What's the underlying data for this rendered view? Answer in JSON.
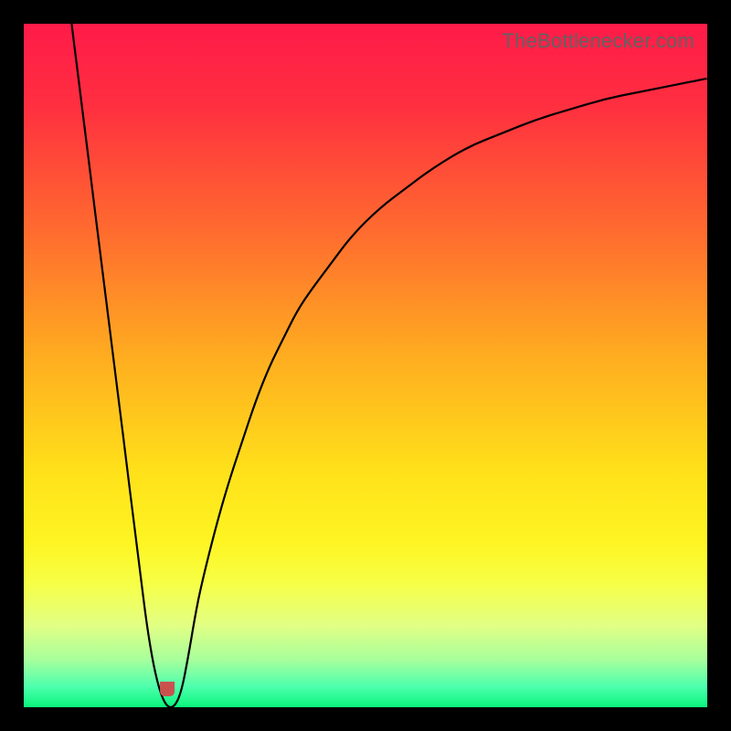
{
  "watermark": "TheBottlenecker.com",
  "colors": {
    "gradient_stops": [
      {
        "offset": "0%",
        "color": "#ff1b49"
      },
      {
        "offset": "12%",
        "color": "#ff2f40"
      },
      {
        "offset": "30%",
        "color": "#ff6a2f"
      },
      {
        "offset": "50%",
        "color": "#ffb11f"
      },
      {
        "offset": "66%",
        "color": "#ffe21a"
      },
      {
        "offset": "76%",
        "color": "#fef523"
      },
      {
        "offset": "82%",
        "color": "#f6ff47"
      },
      {
        "offset": "88%",
        "color": "#e2ff84"
      },
      {
        "offset": "93%",
        "color": "#a8ff9c"
      },
      {
        "offset": "97%",
        "color": "#4dffad"
      },
      {
        "offset": "100%",
        "color": "#09f57b"
      }
    ],
    "curve": "#000000",
    "marker": "#c9524f",
    "frame": "#000000"
  },
  "chart_data": {
    "type": "line",
    "title": "",
    "xlabel": "",
    "ylabel": "",
    "xlim": [
      0,
      100
    ],
    "ylim": [
      0,
      100
    ],
    "x": [
      7,
      8,
      9,
      10,
      11,
      12,
      13,
      14,
      15,
      16,
      17,
      18,
      19,
      20,
      21,
      22,
      23,
      24,
      25,
      26,
      28,
      30,
      32,
      34,
      36,
      38,
      40,
      42,
      45,
      48,
      52,
      56,
      60,
      65,
      70,
      75,
      80,
      85,
      90,
      95,
      100
    ],
    "values": [
      100,
      92,
      84,
      76,
      68,
      60,
      52,
      44,
      36,
      28,
      20,
      12,
      6,
      2,
      0,
      0,
      2,
      7,
      13,
      18,
      26,
      33,
      39,
      45,
      50,
      54,
      58,
      61,
      65,
      69,
      73,
      76,
      79,
      82,
      84,
      86,
      87.5,
      89,
      90,
      91,
      92
    ],
    "marker_x_range": [
      20,
      22
    ],
    "notes": "Single V-shaped curve over a red→yellow→green vertical gradient. Curve minimum (~0) occurs around x≈20–22. Left branch is steep/near-linear; right branch rises with decreasing slope toward ~92 at x=100. Small red U-shaped marker at trough. Values are estimated from the image (no axes or ticks are rendered)."
  }
}
